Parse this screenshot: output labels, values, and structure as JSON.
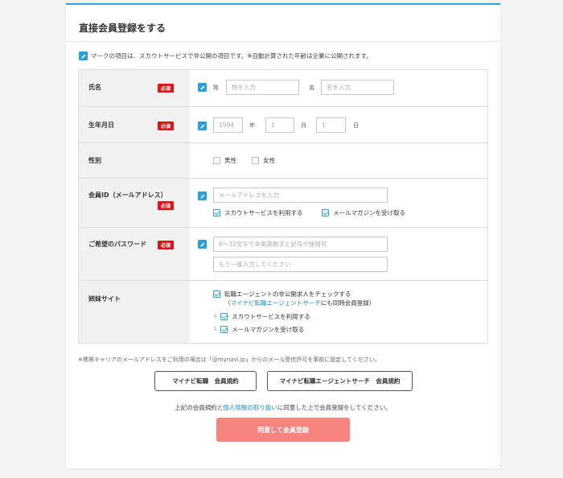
{
  "form": {
    "title": "直接会員登録をする",
    "note": "マークの項目は、スカウトサービスで非公開の項目です。※自動計算された年齢は企業に公開されます。",
    "required_label": "必須",
    "name": {
      "label": "氏名",
      "last_prefix": "姓",
      "last_placeholder": "姓を入力",
      "first_prefix": "名",
      "first_placeholder": "名を入力"
    },
    "birth": {
      "label": "生年月日",
      "year_value": "1994",
      "year_unit": "年",
      "month_value": "1",
      "month_unit": "月",
      "day_value": "1",
      "day_unit": "日"
    },
    "gender": {
      "label": "性別",
      "male": "男性",
      "female": "女性"
    },
    "member_id": {
      "label": "会員ID（メールアドレス）",
      "placeholder": "メールアドレスを入力",
      "scout_option": "スカウトサービスを利用する",
      "magazine_option": "メールマガジンを受け取る"
    },
    "password": {
      "label": "ご希望のパスワード",
      "placeholder": "6〜32文字で半角英数字と記号が使用可",
      "confirm_placeholder": "もう一度入力してください"
    },
    "sister": {
      "label": "姉妹サイト",
      "main_option": "転職エージェントの非公開求人をチェックする",
      "sub_note_pre": "（",
      "sub_note_link": "マイナビ転職エージェントサーチ",
      "sub_note_post": "にも同時会員登録）",
      "corner": "└",
      "scout_option": "スカウトサービスを利用する",
      "magazine_option": "メールマガジンを受け取る"
    },
    "footnote": "※携帯キャリアのメールアドレスをご利用の場合は「@mynavi.jp」からのメール受信許可を事前に設定してください。",
    "terms_button_1": "マイナビ転職　会員規約",
    "terms_button_2": "マイナビ転職エージェントサーチ　会員規約",
    "agree_pre": "上記の会員規約と",
    "agree_link": "個人情報の取り扱い",
    "agree_post": "に同意した上で会員登録をしてください。",
    "submit": "同意して会員登録"
  },
  "colors": {
    "accent": "#2aa4dd",
    "required": "#d9151c",
    "submit": "#f5837f",
    "link": "#1b8ac6"
  },
  "icons": {
    "pen": "pen-icon"
  }
}
